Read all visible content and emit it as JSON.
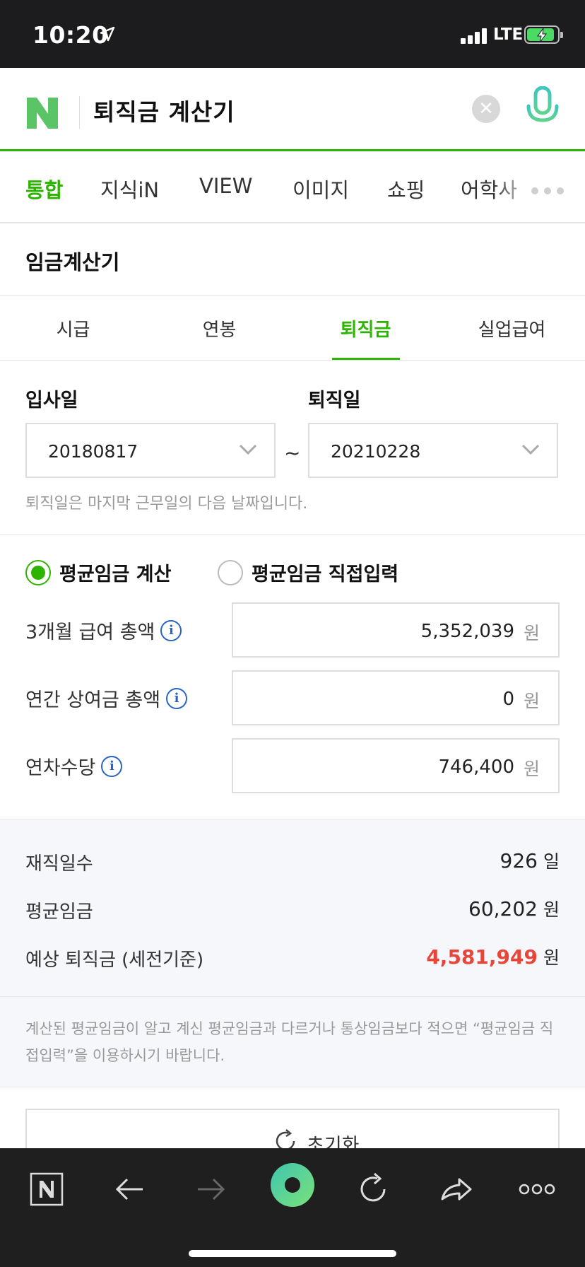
{
  "status": {
    "time": "10:20",
    "network": "LTE"
  },
  "search": {
    "query": "퇴직금 계산기"
  },
  "categories": [
    "통합",
    "지식iN",
    "VIEW",
    "이미지",
    "쇼핑",
    "어학사"
  ],
  "calculator_title": "임금계산기",
  "sub_tabs": [
    "시급",
    "연봉",
    "퇴직금",
    "실업급여"
  ],
  "dates": {
    "start_label": "입사일",
    "start_value": "20180817",
    "end_label": "퇴직일",
    "end_value": "20210228",
    "separator": "~",
    "note": "퇴직일은 마지막 근무일의 다음 날짜입니다."
  },
  "mode": {
    "option1": "평균임금 계산",
    "option2": "평균임금 직접입력",
    "selected": "평균임금 계산"
  },
  "inputs": [
    {
      "label": "3개월 급여 총액",
      "value": "5,352,039",
      "unit": "원"
    },
    {
      "label": "연간 상여금 총액",
      "value": "0",
      "unit": "원"
    },
    {
      "label": "연차수당",
      "value": "746,400",
      "unit": "원"
    }
  ],
  "results": [
    {
      "label": "재직일수",
      "value": "926",
      "unit": "일"
    },
    {
      "label": "평균임금",
      "value": "60,202",
      "unit": "원"
    },
    {
      "label": "예상 퇴직금 (세전기준)",
      "value": "4,581,949",
      "unit": "원",
      "highlight_color": "#e8463a"
    }
  ],
  "notice": "계산된 평균임금이 알고 계신 평균임금과 다르거나 통상임금보다 적으면 “평균임금 직접입력”을 이용하시기 바랍니다.",
  "reset_label": "초기화",
  "colors": {
    "brand_green": "#2db400",
    "result_red": "#e8463a",
    "info_blue": "#2b63c4"
  }
}
